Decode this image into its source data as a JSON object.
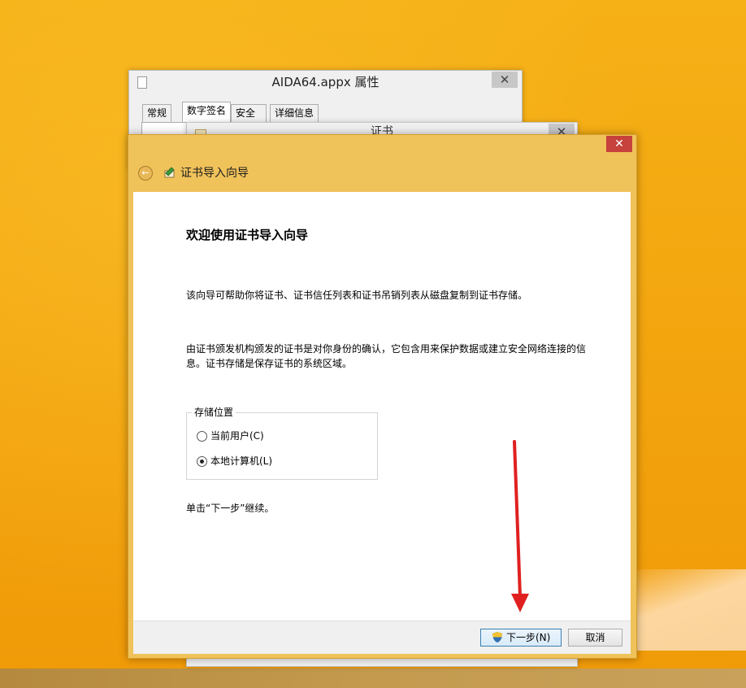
{
  "back_window": {
    "title": "AIDA64.appx 属性",
    "close_symbol": "✕",
    "tabs": [
      {
        "label": "常规"
      },
      {
        "label": "数字签名"
      },
      {
        "label": "安全"
      },
      {
        "label": "详细信息"
      }
    ]
  },
  "mid_window": {
    "title": "证书",
    "close_symbol": "✕"
  },
  "wizard": {
    "close_symbol": "✕",
    "back_symbol": "←",
    "title": "证书导入向导",
    "heading": "欢迎使用证书导入向导",
    "paragraph1": "该向导可帮助你将证书、证书信任列表和证书吊销列表从磁盘复制到证书存储。",
    "paragraph2": "由证书颁发机构颁发的证书是对你身份的确认，它包含用来保护数据或建立安全网络连接的信息。证书存储是保存证书的系统区域。",
    "store_location": {
      "label": "存储位置",
      "options": [
        {
          "label": "当前用户(C)",
          "checked": false
        },
        {
          "label": "本地计算机(L)",
          "checked": true
        }
      ]
    },
    "continue_text": "单击“下一步”继续。",
    "next_button": "下一步(N)",
    "cancel_button": "取消"
  },
  "colors": {
    "desktop": "#f3a60f",
    "wizard_frame": "#f0c25a",
    "close_red": "#c7423c",
    "annotation_arrow": "#e02020"
  },
  "icons": {
    "wizard_icon": "certificate-wizard-icon",
    "shield": "uac-shield-icon"
  }
}
